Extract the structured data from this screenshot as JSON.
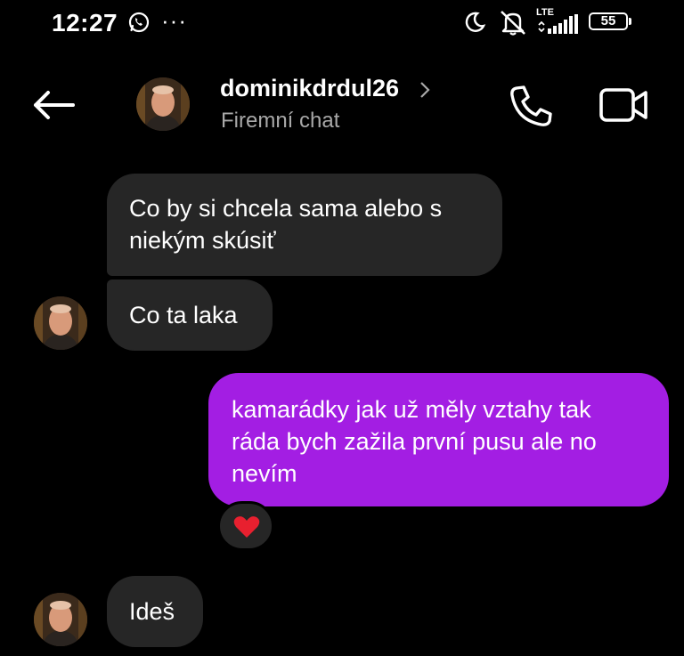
{
  "status_bar": {
    "time": "12:27",
    "more": "···",
    "network": "LTE",
    "battery": "55",
    "icons": [
      "whatsapp-icon",
      "moon-icon",
      "mute-icon",
      "signal-icon",
      "battery-icon"
    ]
  },
  "header": {
    "name": "dominikdrdul26",
    "subtitle": "Firemní chat",
    "icons": [
      "back-arrow-icon",
      "chevron-right-icon",
      "phone-icon",
      "video-icon"
    ]
  },
  "messages": [
    {
      "direction": "incoming",
      "text": "Co by si chcela sama alebo s niekým skúsiť"
    },
    {
      "direction": "incoming",
      "text": "Co ta laka"
    },
    {
      "direction": "outgoing",
      "text": "kamarádky jak už měly vztahy tak ráda bych zažila první pusu ale no nevím",
      "reaction": "heart-icon"
    },
    {
      "direction": "incoming",
      "text": "Ideš"
    }
  ],
  "colors": {
    "background": "#000000",
    "incoming_bubble": "#262626",
    "outgoing_bubble": "#a31ee3",
    "secondary_text": "#a8a8a8",
    "reaction_heart": "#e8202f"
  }
}
